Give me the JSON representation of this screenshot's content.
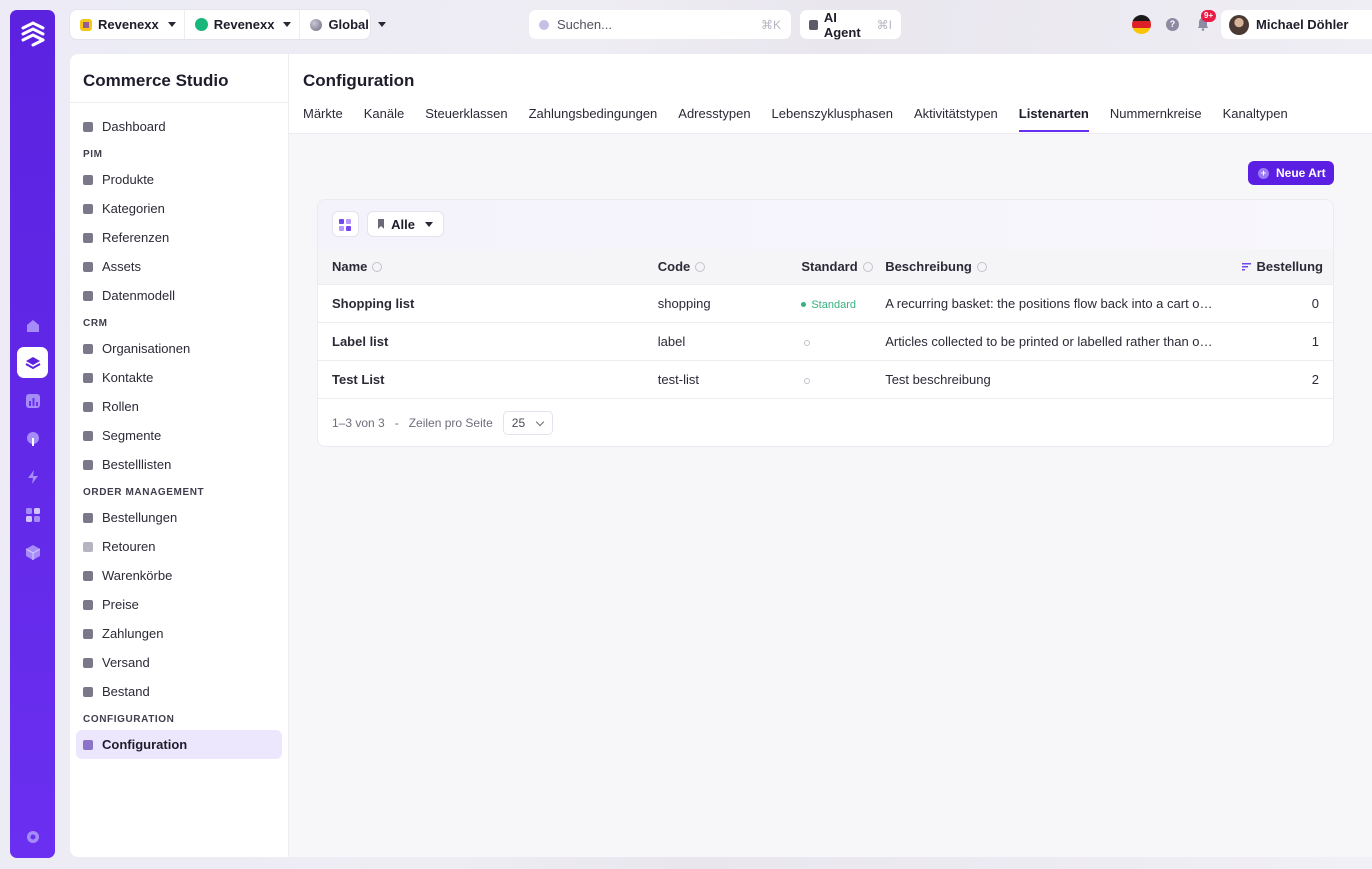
{
  "topbar": {
    "org": "Revenexx",
    "store": "Revenexx",
    "scope": "Global",
    "search": {
      "placeholder": "Suchen...",
      "shortcut": "⌘K"
    },
    "ai_agent": {
      "label": "AI Agent",
      "shortcut": "⌘I"
    },
    "notifications_badge": "9+",
    "user_name": "Michael Döhler"
  },
  "sidebar": {
    "title": "Commerce Studio",
    "top_item": "Dashboard",
    "sections": [
      {
        "title": "PIM",
        "items": [
          "Produkte",
          "Kategorien",
          "Referenzen",
          "Assets",
          "Datenmodell"
        ]
      },
      {
        "title": "CRM",
        "items": [
          "Organisationen",
          "Kontakte",
          "Rollen",
          "Segmente",
          "Bestelllisten"
        ]
      },
      {
        "title": "ORDER MANAGEMENT",
        "items": [
          "Bestellungen",
          "Retouren",
          "Warenkörbe",
          "Preise",
          "Zahlungen",
          "Versand",
          "Bestand"
        ]
      },
      {
        "title": "CONFIGURATION",
        "items": [
          "Configuration"
        ]
      }
    ]
  },
  "main": {
    "title": "Configuration",
    "tabs": [
      "Märkte",
      "Kanäle",
      "Steuerklassen",
      "Zahlungsbedingungen",
      "Adresstypen",
      "Lebenszyklusphasen",
      "Aktivitätstypen",
      "Listenarten",
      "Nummernkreise",
      "Kanaltypen"
    ],
    "active_tab": "Listenarten",
    "new_button": "Neue Art",
    "filter": "Alle",
    "columns": {
      "name": "Name",
      "code": "Code",
      "standard": "Standard",
      "description": "Beschreibung",
      "order": "Bestellung"
    },
    "rows": [
      {
        "name": "Shopping list",
        "code": "shopping",
        "standard": "Standard",
        "description": "A recurring basket: the positions flow back into a cart or an o...",
        "order": "0"
      },
      {
        "name": "Label list",
        "code": "label",
        "standard": "",
        "description": "Articles collected to be printed or labelled rather than ordered.",
        "order": "1"
      },
      {
        "name": "Test List",
        "code": "test-list",
        "standard": "",
        "description": "Test beschreibung",
        "order": "2"
      }
    ],
    "pagination": {
      "range": "1–3 von 3",
      "separator": "-",
      "rows_label": "Zeilen pro Seite",
      "rows_value": "25"
    }
  },
  "colors": {
    "accent": "#5b1fe3",
    "rail": "#6a2ff0",
    "success": "#36b07f"
  }
}
